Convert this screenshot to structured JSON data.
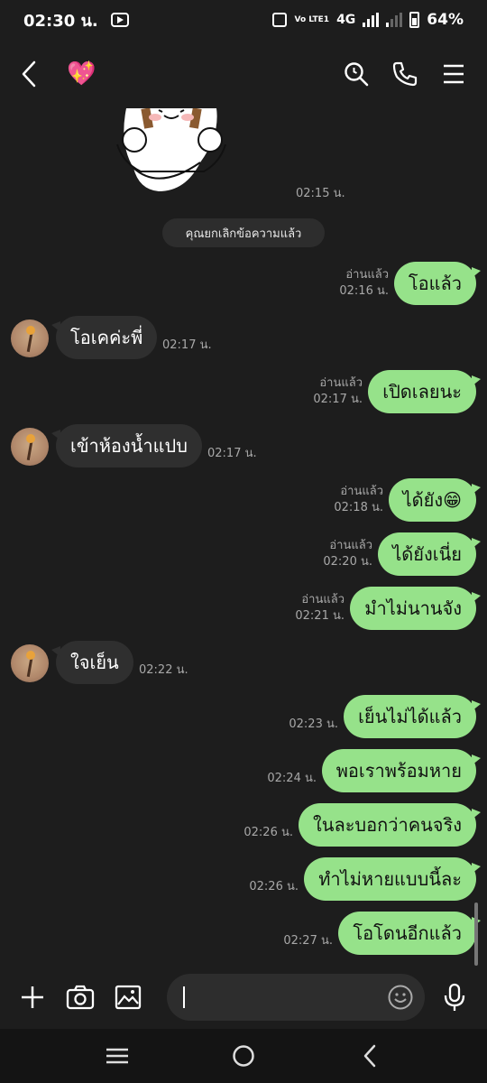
{
  "status_bar": {
    "time": "02:30 น.",
    "network": "4G",
    "volte": "Vo LTE1",
    "battery": "64%"
  },
  "header": {
    "back_icon": "chevron-left-icon",
    "contact_emoji": "💖",
    "icons": [
      "search-icon",
      "phone-icon",
      "menu-icon"
    ]
  },
  "chat": {
    "sticker_time": "02:15 น.",
    "notice": "คุณยกเลิกข้อความแล้ว",
    "read_label": "อ่านแล้ว",
    "messages": [
      {
        "dir": "out",
        "text": "โอแล้ว",
        "time": "02:16 น.",
        "read": true
      },
      {
        "dir": "in",
        "text": "โอเคค่ะพี่",
        "time": "02:17 น."
      },
      {
        "dir": "out",
        "text": "เปิดเลยนะ",
        "time": "02:17 น.",
        "read": true
      },
      {
        "dir": "in",
        "text": "เข้าห้องน้ำแปบ",
        "time": "02:17 น."
      },
      {
        "dir": "out",
        "text": "ได้ยัง😁",
        "time": "02:18 น.",
        "read": true
      },
      {
        "dir": "out",
        "text": "ได้ยังเนี่ย",
        "time": "02:20 น.",
        "read": true
      },
      {
        "dir": "out",
        "text": "มำไม่นานจัง",
        "time": "02:21 น.",
        "read": true
      },
      {
        "dir": "in",
        "text": "ใจเย็น",
        "time": "02:22 น."
      },
      {
        "dir": "out",
        "text": "เย็นไม่ได้แล้ว",
        "time": "02:23 น.",
        "read": false
      },
      {
        "dir": "out",
        "text": "พอเราพร้อมหาย",
        "time": "02:24 น.",
        "read": false
      },
      {
        "dir": "out",
        "text": "ในละบอกว่าคนจริง",
        "time": "02:26 น.",
        "read": false
      },
      {
        "dir": "out",
        "text": "ทำไม่หายแบบนี้ละ",
        "time": "02:26 น.",
        "read": false
      },
      {
        "dir": "out",
        "text": "โอโดนอีกแล้ว",
        "time": "02:27 น.",
        "read": false
      }
    ]
  },
  "input_bar": {
    "icons": [
      "plus-icon",
      "camera-icon",
      "image-icon",
      "emoji-icon",
      "mic-icon"
    ]
  },
  "nav_bar": {
    "icons": [
      "recents-icon",
      "home-icon",
      "back-nav-icon"
    ]
  },
  "colors": {
    "background": "#1d1d1d",
    "outgoing_bubble": "#96e28a",
    "incoming_bubble": "#2f2f2f",
    "meta_text": "#a8a8a8"
  }
}
